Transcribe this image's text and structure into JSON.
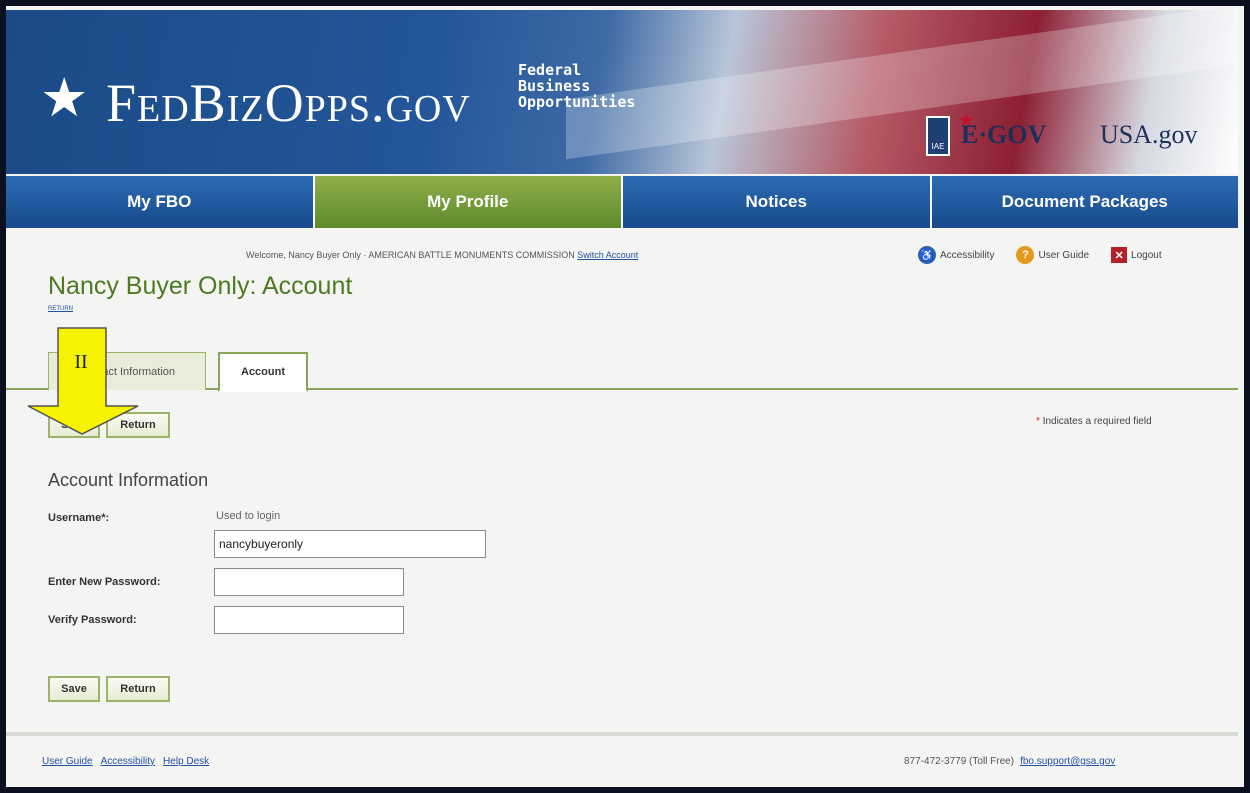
{
  "header": {
    "logo_star": "★",
    "logo_text": "FedBizOpps.gov",
    "logo_sub": [
      "Federal",
      "Business",
      "Opportunities"
    ],
    "seal_text": "IAE",
    "egov_text": "E·GOV",
    "usagov_text": "USA.gov"
  },
  "nav": {
    "items": [
      {
        "label": "My FBO"
      },
      {
        "label": "My Profile"
      },
      {
        "label": "Notices"
      },
      {
        "label": "Document Packages"
      }
    ],
    "active_index": 1
  },
  "welcome": {
    "text": "Welcome, Nancy Buyer Only · AMERICAN BATTLE MONUMENTS COMMISSION",
    "switch_label": "Switch Account"
  },
  "tools": {
    "accessibility": "Accessibility",
    "user_guide": "User Guide",
    "logout": "Logout"
  },
  "page": {
    "title": "Nancy Buyer Only: Account",
    "return_link": "RETURN"
  },
  "tabs": [
    {
      "label": "Contact Information"
    },
    {
      "label": "Account"
    }
  ],
  "buttons": {
    "save": "Save",
    "return": "Return"
  },
  "required_note": {
    "star": "*",
    "text": "Indicates a required field"
  },
  "form": {
    "section_title": "Account Information",
    "username_label": "Username*:",
    "username_hint": "Used to login",
    "username_value": "nancybuyeronly",
    "new_password_label": "Enter New Password:",
    "verify_password_label": "Verify Password:"
  },
  "footer": {
    "links": [
      "User Guide",
      "Accessibility",
      "Help Desk"
    ],
    "phone": "877-472-3779 (Toll Free)",
    "email": "fbo.support@gsa.gov"
  },
  "callout": {
    "label": "II",
    "color": "#f7f200"
  }
}
